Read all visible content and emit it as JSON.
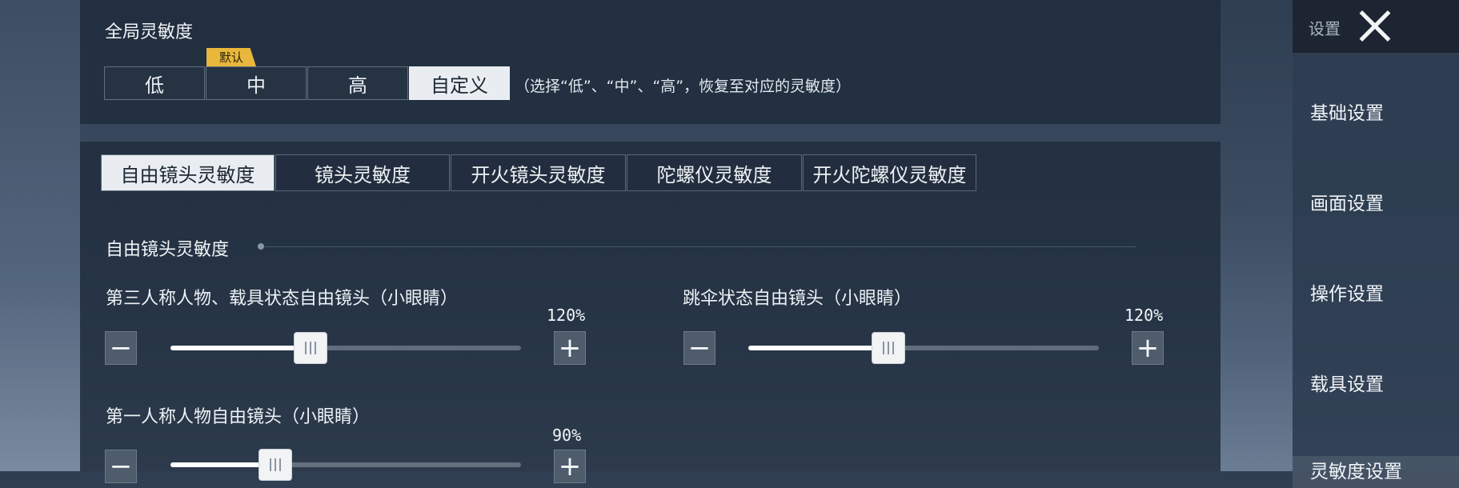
{
  "global": {
    "title": "全局灵敏度",
    "default_badge": "默认",
    "options": [
      "低",
      "中",
      "高",
      "自定义"
    ],
    "selected": "自定义",
    "hint": "（选择“低”、“中”、“高”，恢复至对应的灵敏度）"
  },
  "tabs": [
    {
      "label": "自由镜头灵敏度",
      "active": true
    },
    {
      "label": "镜头灵敏度",
      "active": false
    },
    {
      "label": "开火镜头灵敏度",
      "active": false
    },
    {
      "label": "陀螺仪灵敏度",
      "active": false
    },
    {
      "label": "开火陀螺仪灵敏度",
      "active": false
    }
  ],
  "section": {
    "title": "自由镜头灵敏度"
  },
  "sliders": [
    {
      "label": "第三人称人物、载具状态自由镜头（小眼睛）",
      "value_text": "120%",
      "fraction": 0.4
    },
    {
      "label": "跳伞状态自由镜头（小眼睛）",
      "value_text": "120%",
      "fraction": 0.4
    },
    {
      "label": "第一人称人物自由镜头（小眼睛）",
      "value_text": "90%",
      "fraction": 0.3
    }
  ],
  "stepper": {
    "minus": "−",
    "plus": "+"
  },
  "sidebar": {
    "title": "设置",
    "items": [
      "基础设置",
      "画面设置",
      "操作设置",
      "载具设置",
      "灵敏度设置"
    ],
    "active_index": 4
  }
}
